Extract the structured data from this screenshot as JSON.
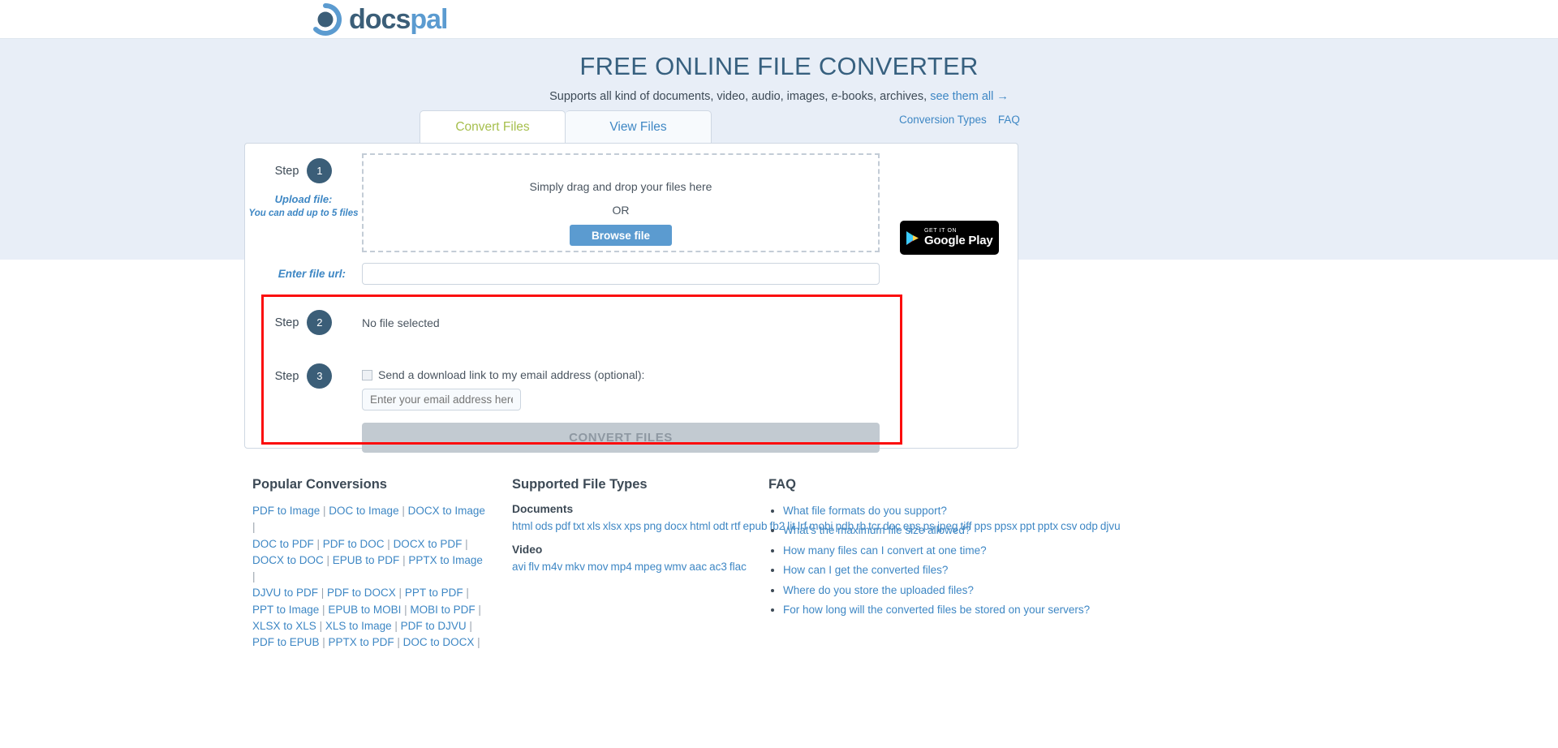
{
  "brand": {
    "name_dark": "docs",
    "name_light": "pal",
    "logo_icon": "docspal-circle-logo"
  },
  "hero": {
    "title": "FREE ONLINE FILE CONVERTER",
    "subtitle": "Supports all kind of documents, video, audio, images, e-books, archives,",
    "subtitle_link": "see them all →",
    "bg_color": "#e8eef7",
    "title_color": "#37607f"
  },
  "tabs": [
    {
      "label": "Convert Files",
      "active": true,
      "color": "#a6bf4d"
    },
    {
      "label": "View Files",
      "active": false,
      "color": "#3e87c4"
    }
  ],
  "hero_nav": [
    {
      "label": "Conversion Types"
    },
    {
      "label": "FAQ"
    }
  ],
  "converter": {
    "step1": {
      "step_word": "Step",
      "number": "1",
      "label": "Upload file:",
      "note": "You can add up to 5 files"
    },
    "dropzone": {
      "drag_text": "Simply drag and drop your files here",
      "or_text": "OR",
      "browse_label": "Browse file"
    },
    "file_url": {
      "label": "Enter file url:",
      "value": "",
      "placeholder": ""
    },
    "step2": {
      "step_word": "Step",
      "number": "2",
      "status": "No file selected"
    },
    "step3": {
      "step_word": "Step",
      "number": "3",
      "checkbox_label": "Send a download link to my email address (optional):",
      "checkbox_checked": false,
      "email_value": "",
      "email_placeholder": "Enter your email address here"
    },
    "convert_label": "CONVERT FILES",
    "convert_disabled": true,
    "highlight_color": "#fb0d0d",
    "step_badge_color": "#3b5e78"
  },
  "google_play": {
    "top_line": "GET IT ON",
    "bottom_line": "Google Play",
    "icon": "google-play-triangle-icon"
  },
  "footer": {
    "popular": {
      "heading": "Popular Conversions",
      "links": [
        "PDF to Image",
        "DOC to Image",
        "DOCX to Image",
        "DOC to PDF",
        "PDF to DOC",
        "DOCX to PDF",
        "DOCX to DOC",
        "EPUB to PDF",
        "PPTX to Image",
        "DJVU to PDF",
        "PDF to DOCX",
        "PPT to PDF",
        "PPT to Image",
        "EPUB to MOBI",
        "MOBI to PDF",
        "XLSX to XLS",
        "XLS to Image",
        "PDF to DJVU",
        "PDF to EPUB",
        "PPTX to PDF",
        "DOC to DOCX"
      ]
    },
    "supported": {
      "heading": "Supported File Types",
      "groups": [
        {
          "title": "Documents",
          "types": [
            "html",
            "ods",
            "pdf",
            "txt",
            "xls",
            "xlsx",
            "xps",
            "png",
            "docx",
            "html",
            "odt",
            "rtf",
            "epub",
            "fb2",
            "lit",
            "lrf",
            "mobi",
            "pdb",
            "rb",
            "tcr",
            "doc",
            "eps",
            "ps",
            "jpeg",
            "tiff",
            "pps",
            "ppsx",
            "ppt",
            "pptx",
            "csv",
            "odp",
            "djvu"
          ]
        },
        {
          "title": "Video",
          "types": [
            "avi",
            "flv",
            "m4v",
            "mkv",
            "mov",
            "mp4",
            "mpeg",
            "wmv",
            "aac",
            "ac3",
            "flac"
          ]
        }
      ]
    },
    "faq": {
      "heading": "FAQ",
      "items": [
        "What file formats do you support?",
        "What's the maximum file size allowed?",
        "How many files can I convert at one time?",
        "How can I get the converted files?",
        "Where do you store the uploaded files?",
        "For how long will the converted files be stored on your servers?"
      ]
    }
  }
}
